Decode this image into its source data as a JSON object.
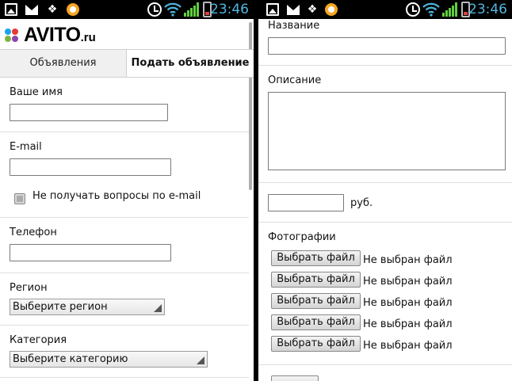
{
  "status_bar": {
    "time": "23:46",
    "icons": [
      "gallery-icon",
      "mail-icon",
      "dropbox-icon",
      "app-icon",
      "alarm-icon",
      "wifi-icon",
      "signal-icon",
      "battery-icon"
    ],
    "clock_color": "#4fb6e0",
    "signal_color": "#5fcf3f"
  },
  "brand": {
    "name": "AVITO",
    "tld": ".ru",
    "dot_colors": [
      "#1aa3e8",
      "#e53935",
      "#7cb342",
      "#8e44ad"
    ]
  },
  "tabs": [
    {
      "label": "Объявления",
      "active": false
    },
    {
      "label": "Подать объявление",
      "active": true
    }
  ],
  "form_left": {
    "name_label": "Ваше имя",
    "name_value": "",
    "email_label": "E-mail",
    "email_value": "",
    "no_questions_label": "Не получать вопросы по e-mail",
    "no_questions_checked": false,
    "phone_label": "Телефон",
    "phone_value": "",
    "region_label": "Регион",
    "region_value": "Выберите регион",
    "category_label": "Категория",
    "category_value": "Выберите категорию"
  },
  "form_right": {
    "title_label": "Название",
    "title_value": "",
    "description_label": "Описание",
    "description_value": "",
    "price_value": "",
    "price_unit": "руб.",
    "photos_label": "Фотографии",
    "file_inputs": [
      {
        "button": "Выбрать файл",
        "status": "Не выбран файл"
      },
      {
        "button": "Выбрать файл",
        "status": "Не выбран файл"
      },
      {
        "button": "Выбрать файл",
        "status": "Не выбран файл"
      },
      {
        "button": "Выбрать файл",
        "status": "Не выбран файл"
      },
      {
        "button": "Выбрать файл",
        "status": "Не выбран файл"
      }
    ]
  }
}
